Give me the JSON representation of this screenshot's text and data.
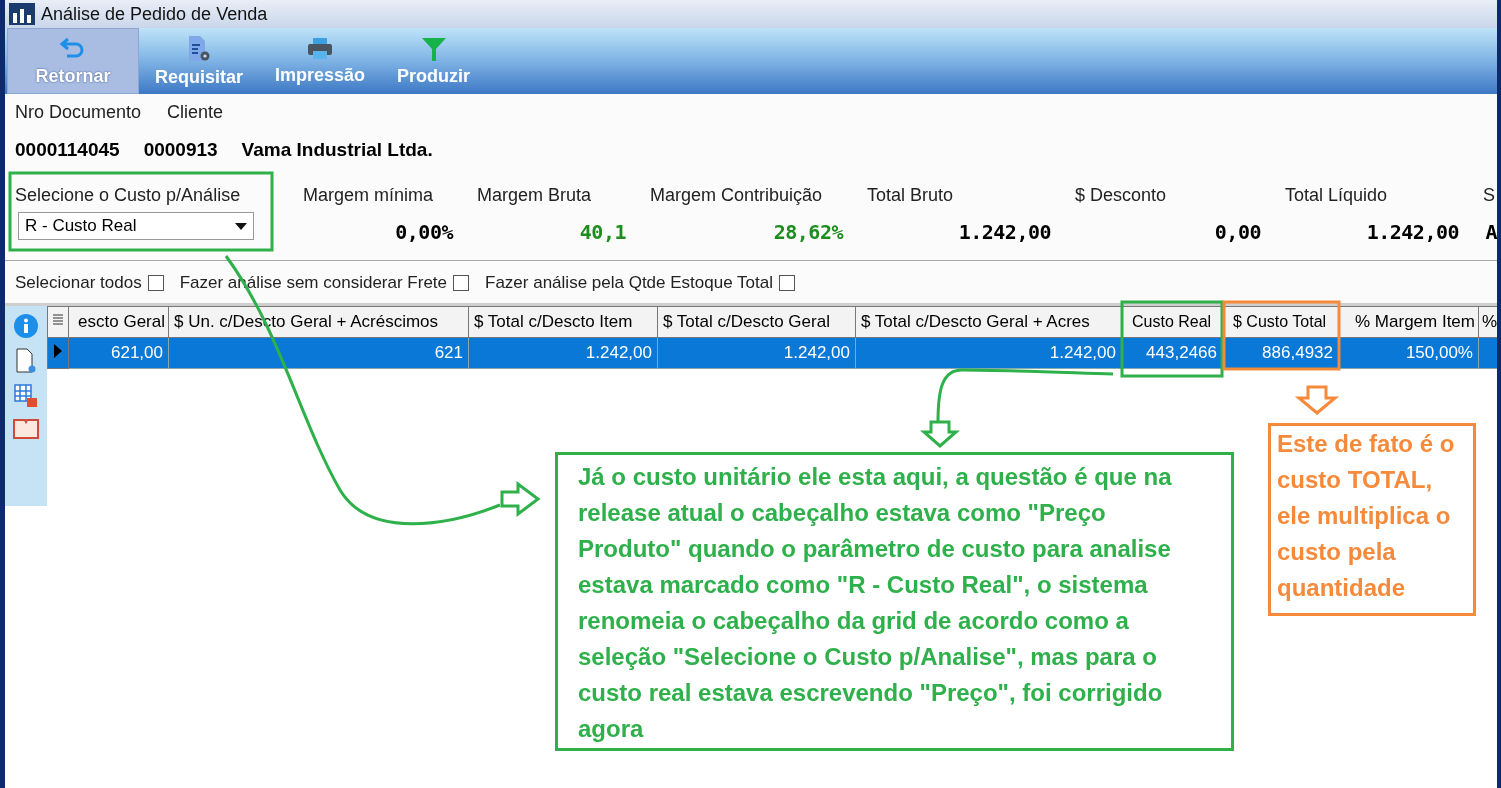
{
  "window": {
    "title": "Análise de Pedido de Venda"
  },
  "toolbar": [
    {
      "label": "Retornar",
      "selected": true,
      "kind": "return"
    },
    {
      "label": "Requisitar",
      "selected": false,
      "kind": "request"
    },
    {
      "label": "Impressão",
      "selected": false,
      "kind": "print"
    },
    {
      "label": "Produzir",
      "selected": false,
      "kind": "filter"
    }
  ],
  "document": {
    "number_label": "Nro Documento",
    "client_label": "Cliente",
    "number": "0000114045",
    "client_code": "0000913",
    "client_name": "Vama Industrial Ltda."
  },
  "cost_selector": {
    "label": "Selecione o Custo p/Análise",
    "value": "R - Custo Real"
  },
  "summary": [
    {
      "label": "Margem mínima",
      "value": "0,00%",
      "color": "#000000"
    },
    {
      "label": "Margem Bruta",
      "value": "40,1",
      "color": "#1e8c1e"
    },
    {
      "label": "Margem Contribuição",
      "value": "28,62%",
      "color": "#1e8c1e"
    },
    {
      "label": "Total Bruto",
      "value": "1.242,00",
      "color": "#000000"
    },
    {
      "label": "$ Desconto",
      "value": "0,00",
      "color": "#000000"
    },
    {
      "label": "Total Líquido",
      "value": "1.242,00",
      "color": "#000000"
    },
    {
      "label": "S",
      "value": "A",
      "color": "#000000"
    }
  ],
  "options": [
    {
      "label": "Selecionar todos",
      "checked": false
    },
    {
      "label": "Fazer análise sem considerar Frete",
      "checked": false
    },
    {
      "label": "Fazer análise pela Qtde Estoque Total",
      "checked": false
    }
  ],
  "table": {
    "columns": [
      "escto Geral",
      "$ Un. c/Descto Geral + Acréscimos",
      "$ Total c/Descto Item",
      "$ Total c/Descto Geral",
      "$ Total c/Descto Geral + Acres",
      "Custo Real",
      "$ Custo Total",
      "% Margem Item",
      "%"
    ],
    "rows": [
      {
        "selected": true,
        "cells": [
          "621,00",
          "621",
          "1.242,00",
          "1.242,00",
          "1.242,00",
          "443,2466",
          "886,4932",
          "150,00%",
          ""
        ]
      }
    ]
  },
  "annotations": [
    {
      "text": "Já o custo unitário ele esta aqui, a questão é que na release atual o cabeçalho estava como \"Preço Produto\" quando o parâmetro de custo para analise estava marcado como \"R - Custo Real\", o sistema renomeia o cabeçalho da grid de acordo como a seleção \"Selecione o Custo p/Analise\", mas para o custo real estava escrevendo \"Preço\", foi corrigido agora",
      "color": "#2eb04a"
    },
    {
      "text": "Este de fato é o custo TOTAL, ele multiplica o custo pela quantidade",
      "color": "#f58a3a"
    }
  ]
}
